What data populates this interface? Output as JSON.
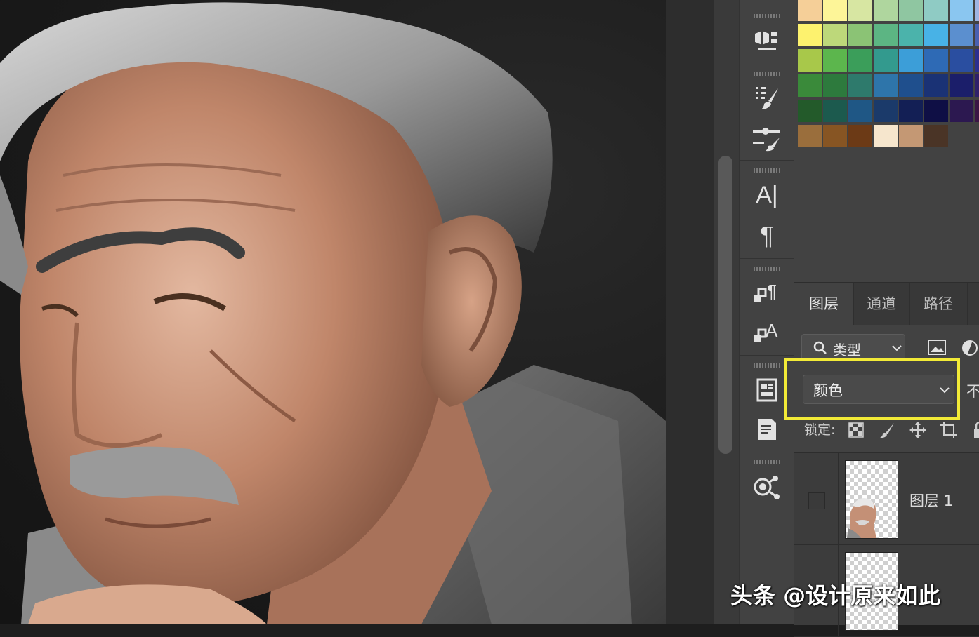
{
  "canvas": {
    "subject": "photo-elderly-man-partially-colorized"
  },
  "toolstrip": {
    "icons": [
      "3d-panel-icon",
      "brush-settings-icon",
      "brush-presets-icon",
      "character-icon",
      "paragraph-icon",
      "paragraph-styles-icon",
      "character-styles-icon",
      "libraries-icon",
      "properties-icon",
      "cc-share-icon"
    ],
    "character_glyph": "A|",
    "paragraph_glyph": "¶"
  },
  "swatches": {
    "rows": [
      [
        "#f5cf98",
        "#fdf598",
        "#d7e6a2",
        "#afd69e",
        "#8fc6a1",
        "#8fcbc4",
        "#8ac6f0",
        "#9fb4e2"
      ],
      [
        "#fdf26e",
        "#bdd87a",
        "#8bc375",
        "#5cb583",
        "#4bb3ab",
        "#48b2e6",
        "#5b8fcf",
        "#4a60b0"
      ],
      [
        "#a8c84a",
        "#5cb64d",
        "#3b9e5a",
        "#339a8e",
        "#3c9ed8",
        "#2e6ab5",
        "#2a4ea0",
        "#2c2f8f"
      ],
      [
        "#3a8a3a",
        "#2d7a3d",
        "#2e7a6c",
        "#2e75aa",
        "#1f4f8d",
        "#1a3275",
        "#1b1e6a",
        "#30206a"
      ],
      [
        "#235a2a",
        "#1c5a4e",
        "#1f5785",
        "#1b3a6a",
        "#131f55",
        "#0f0f45",
        "#2c1850",
        "#3b1545"
      ],
      [
        "#9a6e3c",
        "#875523",
        "#6c3a16",
        "#f6e6cd",
        "#c49874",
        "#4a3426"
      ]
    ]
  },
  "layers_panel": {
    "tabs": [
      {
        "label": "图层",
        "active": true
      },
      {
        "label": "通道",
        "active": false
      },
      {
        "label": "路径",
        "active": false
      }
    ],
    "filter": {
      "icon": "search-icon",
      "label": "类型",
      "kind_icons": [
        "image-filter-icon",
        "adjustment-filter-icon"
      ]
    },
    "blend_mode": "颜色",
    "opacity_label": "不",
    "lock_label": "锁定:",
    "lock_icons": [
      "lock-transparent-icon",
      "lock-image-icon",
      "lock-position-icon",
      "lock-artboard-icon",
      "lock-all-icon"
    ],
    "layers": [
      {
        "name": "图层 1",
        "visible": false
      },
      {
        "name": "",
        "visible": false
      }
    ]
  },
  "highlight_color": "#f2ea37",
  "watermark": "头条 @设计原来如此"
}
